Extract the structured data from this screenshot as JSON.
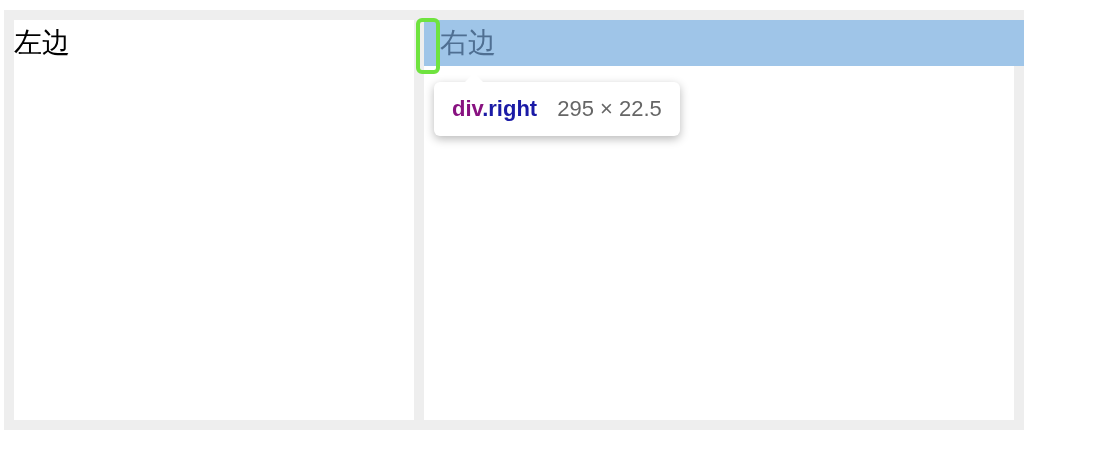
{
  "left_panel": {
    "text": "左边"
  },
  "right_panel": {
    "text": "右边",
    "highlighted": true
  },
  "tooltip": {
    "tag": "div",
    "class_name": ".right",
    "dimensions": "295 × 22.5"
  }
}
